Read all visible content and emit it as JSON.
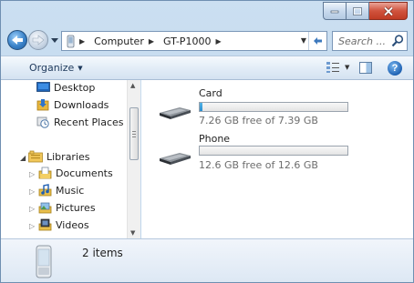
{
  "window": {
    "caption_buttons": [
      "minimize",
      "maximize",
      "close"
    ]
  },
  "address_bar": {
    "segments": [
      "Computer",
      "GT-P1000"
    ],
    "search_placeholder": "Search ..."
  },
  "command_bar": {
    "organize_label": "Organize"
  },
  "nav_pane": {
    "favorites": [
      {
        "label": "Desktop",
        "icon": "desktop-icon"
      },
      {
        "label": "Downloads",
        "icon": "downloads-icon"
      },
      {
        "label": "Recent Places",
        "icon": "recent-places-icon"
      }
    ],
    "libraries_label": "Libraries",
    "libraries": [
      {
        "label": "Documents",
        "icon": "documents-icon"
      },
      {
        "label": "Music",
        "icon": "music-icon"
      },
      {
        "label": "Pictures",
        "icon": "pictures-icon"
      },
      {
        "label": "Videos",
        "icon": "videos-icon"
      }
    ]
  },
  "drives": [
    {
      "name": "Card",
      "free_text": "7.26 GB free of 7.39 GB",
      "used_fraction": 0.018
    },
    {
      "name": "Phone",
      "free_text": "12.6 GB free of 12.6 GB",
      "used_fraction": 0.0
    }
  ],
  "details_pane": {
    "items_count": "2 items"
  },
  "colors": {
    "accent": "#2a8ed1",
    "close_button": "#c03b24"
  }
}
